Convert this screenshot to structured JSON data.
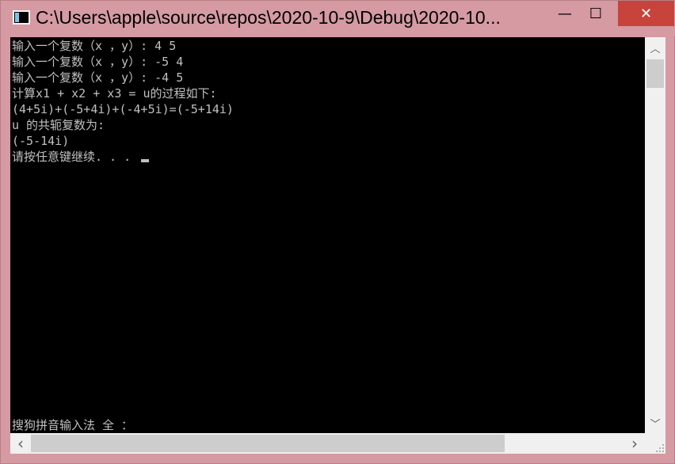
{
  "window": {
    "title": "C:\\Users\\apple\\source\\repos\\2020-10-9\\Debug\\2020-10...",
    "controls": {
      "minimize": "—",
      "maximize": "☐",
      "close": "✕"
    }
  },
  "console": {
    "lines": [
      "输入一个复数（x ，y）: 4 5",
      "输入一个复数（x ，y）: -5 4",
      "输入一个复数（x ，y）: -4 5",
      "计算x1 + x2 + x3 = u的过程如下:",
      "(4+5i)+(-5+4i)+(-4+5i)=(-5+14i)",
      "u 的共轭复数为:",
      "(-5-14i)",
      "请按任意键继续. . . "
    ],
    "ime_status": "搜狗拼音输入法 全 ："
  },
  "scrollbars": {
    "up": "︿",
    "down": "﹀",
    "left": "‹",
    "right": "›"
  }
}
